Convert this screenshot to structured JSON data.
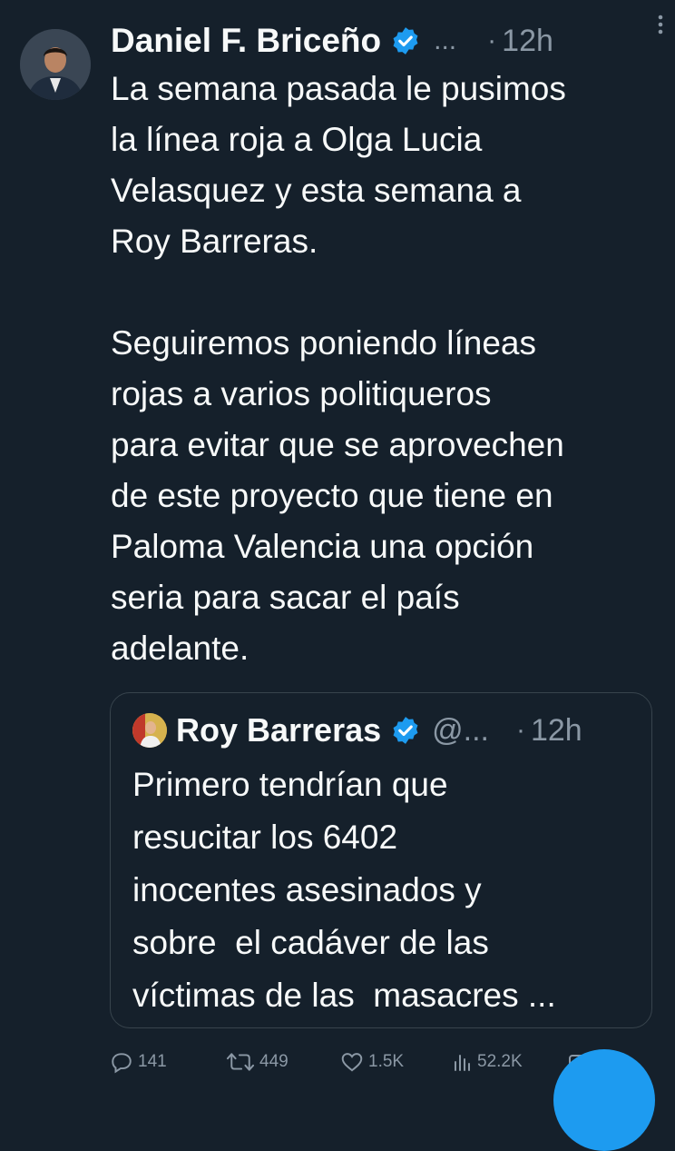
{
  "tweet": {
    "author_name": "Daniel F. Briceño",
    "handle": "...",
    "time_sep": "·",
    "time": "12h",
    "text": "La semana pasada le pusimos\nla línea roja a Olga Lucia\nVelasquez y esta semana a\nRoy Barreras.\n\nSeguiremos poniendo líneas\nrojas a varios politiqueros\npara evitar que se aprovechen\nde este proyecto que tiene en\nPaloma Valencia una opción\nseria para sacar el país\nadelante."
  },
  "quote": {
    "author_name": "Roy Barreras",
    "handle": "@...",
    "time_sep": "·",
    "time": "12h",
    "text": "Primero tendrían que\nresucitar los 6402\ninocentes asesinados y\nsobre  el cadáver de las\nvíctimas de las  masacres ..."
  },
  "actions": {
    "replies": "141",
    "retweets": "449",
    "likes": "1.5K",
    "views": "52.2K"
  },
  "colors": {
    "background": "#15202b",
    "text": "#f7f9f9",
    "muted": "#8b98a5",
    "accent": "#1d9bf0",
    "border": "#38444d"
  },
  "icons": {
    "verified": "verified-badge-icon",
    "more": "more-vertical-icon",
    "reply": "reply-icon",
    "retweet": "retweet-icon",
    "like": "heart-icon",
    "views": "views-chart-icon",
    "share": "share-icon"
  }
}
